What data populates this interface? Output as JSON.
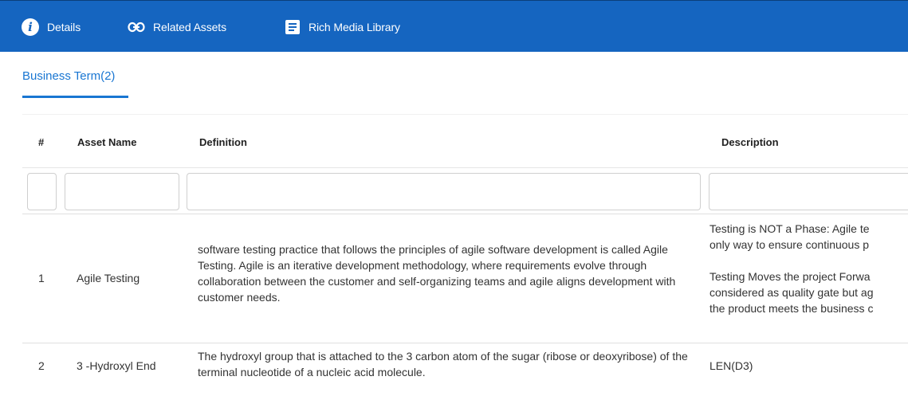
{
  "topbar": {
    "details_label": "Details",
    "related_label": "Related Assets",
    "rich_media_label": "Rich Media Library"
  },
  "tabs": [
    {
      "label": "Business Term(2)"
    }
  ],
  "table": {
    "headers": [
      "#",
      "Asset Name",
      "Definition",
      "Description"
    ],
    "rows": [
      {
        "num": "1",
        "name": "Agile Testing",
        "definition": "software testing practice that follows the principles of agile software development is called Agile Testing. Agile is an iterative development methodology, where requirements evolve through collaboration between the customer and self-organizing teams and agile aligns development with customer needs.",
        "description": "Testing is NOT a Phase: Agile te\nonly way to ensure continuous p\n\nTesting Moves the project Forwa\nconsidered as quality gate but ag\nthe product meets the business c"
      },
      {
        "num": "2",
        "name": "3 -Hydroxyl End",
        "definition": "The hydroxyl group that is attached to the 3 carbon atom of the sugar (ribose or deoxyribose) of the terminal nucleotide of a nucleic acid molecule.",
        "description": "LEN(D3)"
      }
    ]
  }
}
